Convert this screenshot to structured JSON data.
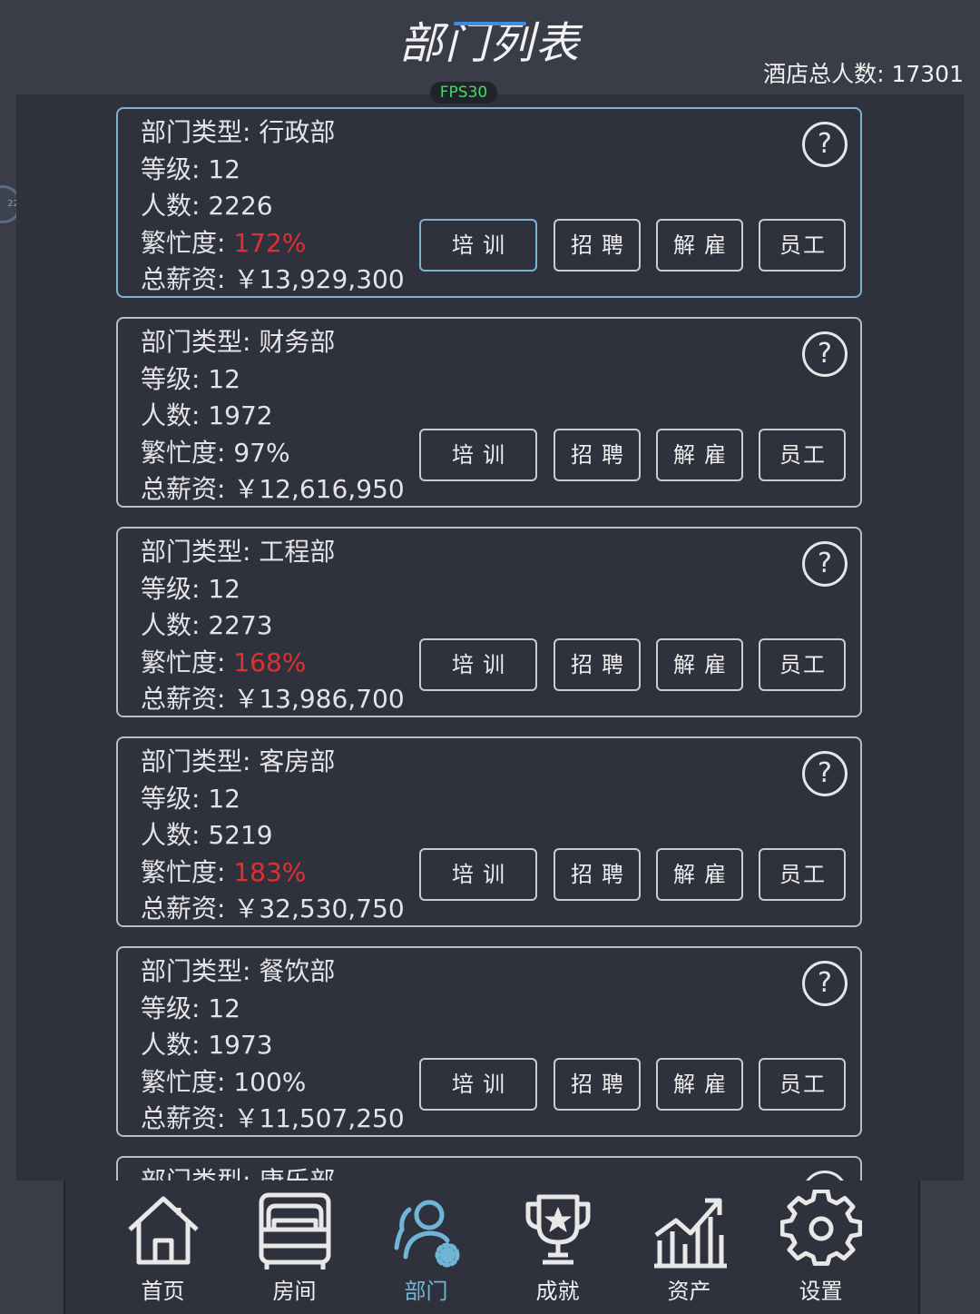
{
  "header": {
    "title": "部门列表",
    "hotel_total": "酒店总人数: 17301",
    "fps": "FPS30",
    "side_badge": "22"
  },
  "buttons": {
    "train": "培训",
    "hire": "招聘",
    "fire": "解雇",
    "staff": "员工",
    "help": "?"
  },
  "departments": [
    {
      "type": "部门类型: 行政部",
      "level": "等级: 12",
      "people": "人数: 2226",
      "busy_label": "繁忙度: ",
      "busy": "172%",
      "salary": "总薪资: ￥13,929,300"
    },
    {
      "type": "部门类型: 财务部",
      "level": "等级: 12",
      "people": "人数: 1972",
      "busy_label": "繁忙度: ",
      "busy": "97%",
      "salary": "总薪资: ￥12,616,950"
    },
    {
      "type": "部门类型: 工程部",
      "level": "等级: 12",
      "people": "人数: 2273",
      "busy_label": "繁忙度: ",
      "busy": "168%",
      "salary": "总薪资: ￥13,986,700"
    },
    {
      "type": "部门类型: 客房部",
      "level": "等级: 12",
      "people": "人数: 5219",
      "busy_label": "繁忙度: ",
      "busy": "183%",
      "salary": "总薪资: ￥32,530,750"
    },
    {
      "type": "部门类型: 餐饮部",
      "level": "等级: 12",
      "people": "人数: 1973",
      "busy_label": "繁忙度: ",
      "busy": "100%",
      "salary": "总薪资: ￥11,507,250"
    },
    {
      "type": "部门类型: 康乐部"
    }
  ],
  "nav": [
    {
      "label": "首页",
      "icon": "home-icon"
    },
    {
      "label": "房间",
      "icon": "bed-icon"
    },
    {
      "label": "部门",
      "icon": "department-icon"
    },
    {
      "label": "成就",
      "icon": "trophy-icon"
    },
    {
      "label": "资产",
      "icon": "chart-icon"
    },
    {
      "label": "设置",
      "icon": "gear-icon"
    }
  ],
  "colors": {
    "background": "#3a3d48",
    "panel": "#2f323d",
    "accent": "#6fb5d6",
    "busy_high": "#e03030",
    "fps": "#3fdc5a"
  }
}
